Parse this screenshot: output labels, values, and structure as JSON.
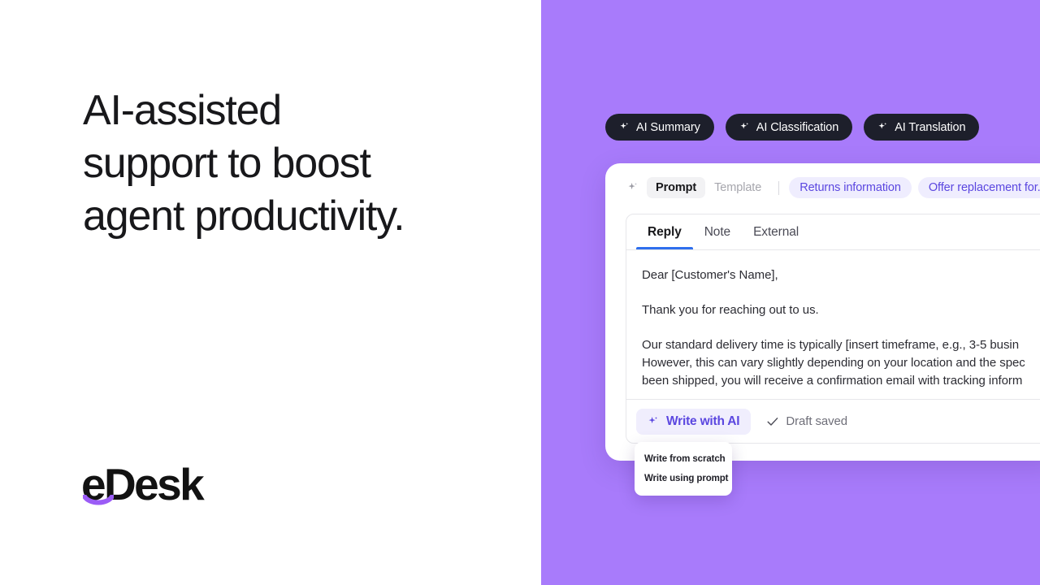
{
  "left": {
    "headline_lines": [
      "AI-assisted",
      "support to boost",
      "agent productivity."
    ],
    "logo_text": "eDesk",
    "logo_swoosh_color": "#9b5cf6"
  },
  "right": {
    "background_color": "#a87bfb",
    "ai_pills": [
      {
        "label": "AI Summary",
        "icon": "sparkle-icon"
      },
      {
        "label": "AI Classification",
        "icon": "sparkle-icon"
      },
      {
        "label": "AI Translation",
        "icon": "sparkle-icon"
      }
    ],
    "card": {
      "prompt_row": {
        "sparkle_icon": "sparkle-icon",
        "segments": [
          {
            "label": "Prompt",
            "active": true
          },
          {
            "label": "Template",
            "active": false
          }
        ],
        "chips": [
          "Returns information",
          "Offer replacement for..."
        ]
      },
      "editor": {
        "tabs": [
          {
            "label": "Reply",
            "active": true
          },
          {
            "label": "Note",
            "active": false
          },
          {
            "label": "External",
            "active": false
          }
        ],
        "accent_color": "#2f6fed",
        "body": {
          "greeting": "Dear [Customer's Name],",
          "thanks": "Thank you for reaching out to us.",
          "paragraph_lines": [
            "Our standard delivery time is typically [insert timeframe, e.g., 3-5 busin",
            "However, this can vary slightly depending on your location and the spec",
            "been shipped, you will receive a confirmation email with tracking inform"
          ]
        },
        "footer": {
          "write_with_ai_label": "Write with AI",
          "write_with_ai_icon": "sparkle-icon",
          "draft_status_label": "Draft saved",
          "draft_status_icon": "check-icon",
          "trailing_icon": "clipboard-icon",
          "accent_color": "#5b47e0"
        }
      },
      "dropdown": {
        "items": [
          "Write from scratch",
          "Write using prompt"
        ]
      }
    }
  }
}
